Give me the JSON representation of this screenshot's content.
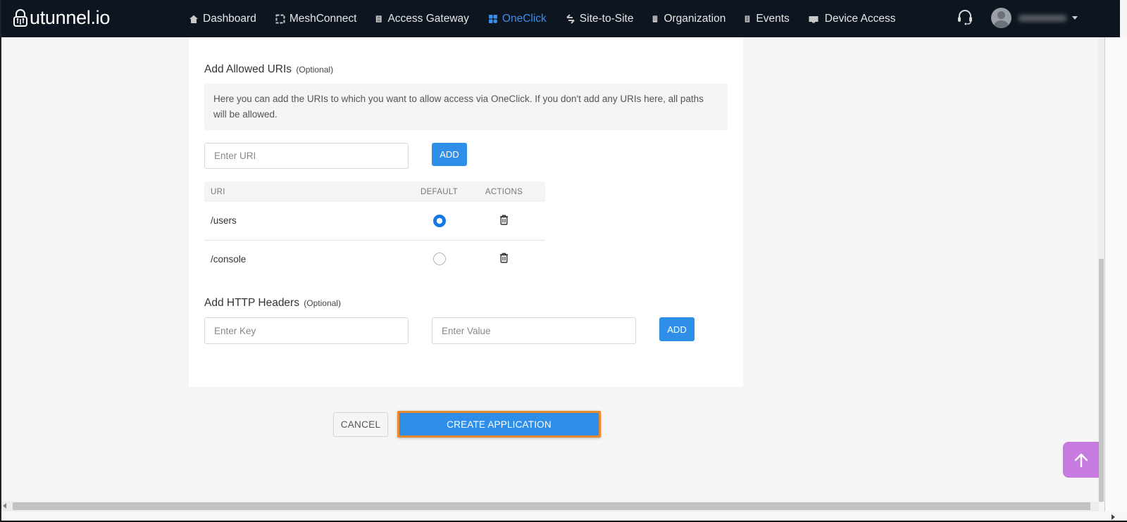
{
  "app": {
    "logo_text": "utunnel.io"
  },
  "navbar": {
    "items": [
      {
        "label": "Dashboard",
        "icon": "home-icon",
        "active": false
      },
      {
        "label": "MeshConnect",
        "icon": "mesh-icon",
        "active": false
      },
      {
        "label": "Access Gateway",
        "icon": "gateway-icon",
        "active": false
      },
      {
        "label": "OneClick",
        "icon": "grid-icon",
        "active": true
      },
      {
        "label": "Site-to-Site",
        "icon": "arrows-exchange-icon",
        "active": false
      },
      {
        "label": "Organization",
        "icon": "building-icon",
        "active": false
      },
      {
        "label": "Events",
        "icon": "document-icon",
        "active": false
      },
      {
        "label": "Device Access",
        "icon": "monitor-icon",
        "active": false
      }
    ],
    "support_icon": "headset-icon",
    "user": {
      "name": "(blurred)",
      "avatar_icon": "user-avatar-icon"
    },
    "accent_color": "#3b8de6",
    "background_color": "#0d1620"
  },
  "allowed_uris": {
    "title": "Add Allowed URIs",
    "optional_label": "(Optional)",
    "info_text": "Here you can add the URIs to which you want to allow access via OneClick. If you don't add any URIs here, all paths will be allowed.",
    "input_placeholder": "Enter URI",
    "input_value": "",
    "add_label": "ADD",
    "table": {
      "columns": [
        "URI",
        "DEFAULT",
        "ACTIONS"
      ],
      "rows": [
        {
          "uri": "/users",
          "default": true
        },
        {
          "uri": "/console",
          "default": false
        }
      ]
    }
  },
  "http_headers": {
    "title": "Add HTTP Headers",
    "optional_label": "(Optional)",
    "key_placeholder": "Enter Key",
    "value_placeholder": "Enter Value",
    "add_label": "ADD"
  },
  "footer": {
    "cancel_label": "CANCEL",
    "create_label": "CREATE APPLICATION",
    "primary_color": "#2f8fe8",
    "highlight_color": "#e8892b"
  },
  "back_to_top": {
    "icon": "arrow-up-icon",
    "color": "#c77ae0"
  }
}
